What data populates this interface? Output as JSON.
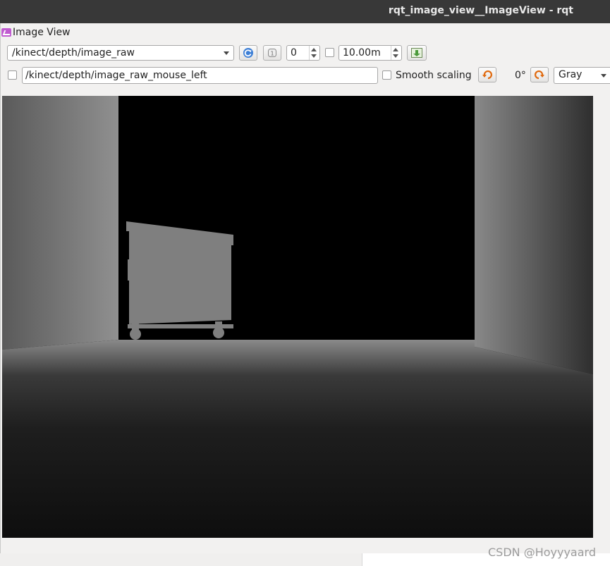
{
  "window": {
    "title": "rqt_image_view__ImageView - rqt"
  },
  "plugin": {
    "title": "Image View",
    "icon": "image-view-icon"
  },
  "toolbar": {
    "topic": "/kinect/depth/image_raw",
    "refresh_icon": "refresh-icon",
    "zoom_icon": "zoom-1-icon",
    "spin_value": "0",
    "max_range": "10.00m",
    "save_icon": "save-image-icon"
  },
  "row2": {
    "mouse_topic": "/kinect/depth/image_raw_mouse_left",
    "smooth_scaling_label": "Smooth scaling",
    "rotate_left_icon": "rotate-ccw-icon",
    "rotation": "0°",
    "rotate_right_icon": "rotate-cw-icon",
    "colormap": "Gray"
  },
  "watermark": "CSDN @Hoyyyaard",
  "colors": {
    "titlebar": "#383838",
    "panel": "#f2f1f0",
    "image_background": "#000000",
    "object_gray": "#7f7f7f"
  }
}
